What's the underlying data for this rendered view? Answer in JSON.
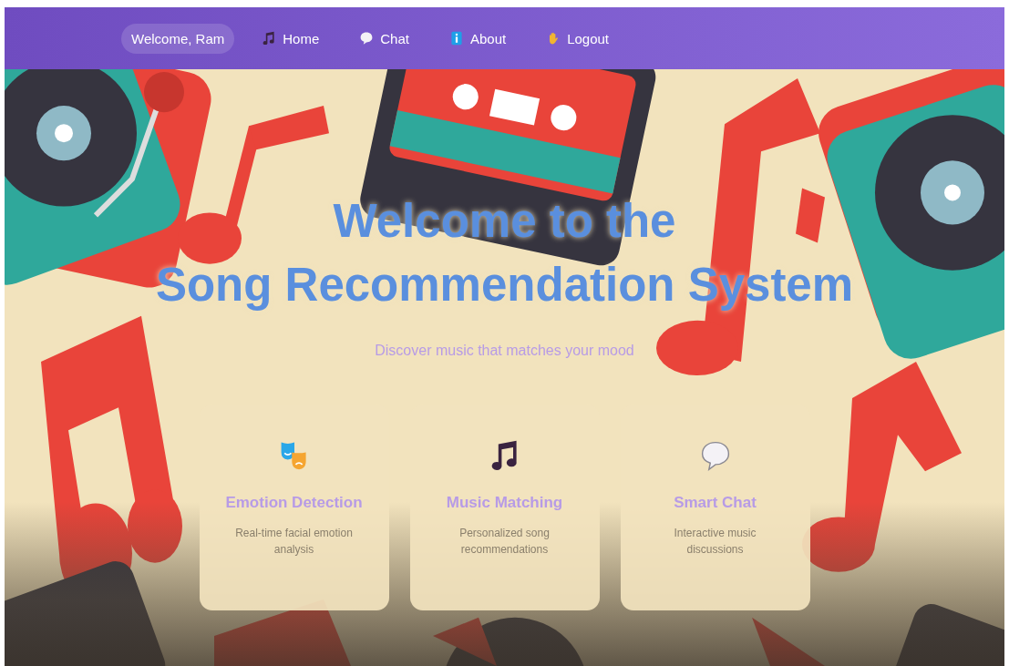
{
  "navbar": {
    "greeting": "Welcome, Ram",
    "links": [
      {
        "label": "Home",
        "kind": "note",
        "selected": false
      },
      {
        "label": "Chat",
        "kind": "speech",
        "selected": false
      },
      {
        "label": "About",
        "kind": "info",
        "selected": false
      },
      {
        "label": "Logout",
        "kind": "hand",
        "selected": false
      }
    ]
  },
  "hero": {
    "title_line_1": "Welcome to the",
    "title_line_2": "Song Recommendation System",
    "subtitle": "Discover music that matches your mood"
  },
  "features": [
    {
      "kind": "masks",
      "title": "Emotion Detection",
      "description": "Real-time facial emotion analysis"
    },
    {
      "kind": "notes",
      "title": "Music Matching",
      "description": "Personalized song recommendations"
    },
    {
      "kind": "speech",
      "title": "Smart Chat",
      "description": "Interactive music discussions"
    }
  ]
}
